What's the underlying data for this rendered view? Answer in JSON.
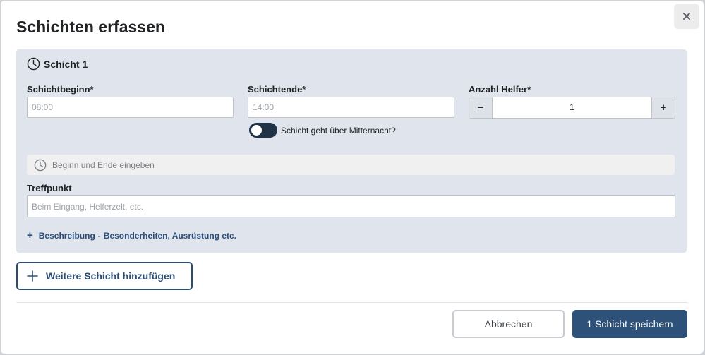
{
  "dialog": {
    "title": "Schichten erfassen",
    "close_icon": "close-icon"
  },
  "shift": {
    "title": "Schicht 1",
    "start": {
      "label": "Schichtbeginn*",
      "placeholder": "08:00",
      "value": ""
    },
    "end": {
      "label": "Schichtende*",
      "placeholder": "14:00",
      "value": ""
    },
    "helpers": {
      "label": "Anzahl Helfer*",
      "value": "1",
      "minus": "−",
      "plus": "+"
    },
    "overnight": {
      "label": "Schicht geht über Mitternacht?",
      "enabled": false
    },
    "hint": "Beginn und Ende eingeben",
    "meeting_point": {
      "label": "Treffpunkt",
      "placeholder": "Beim Eingang, Helferzelt, etc.",
      "value": ""
    },
    "description_link": {
      "plus": "+",
      "label": "Beschreibung",
      "dash": "-",
      "hint": "Besonderheiten, Ausrüstung etc."
    }
  },
  "add_shift": {
    "label": "Weitere Schicht hinzufügen"
  },
  "footer": {
    "cancel_label": "Abbrechen",
    "save_label": "1 Schicht speichern"
  },
  "colors": {
    "primary": "#2d5179",
    "card_background": "#dfe4ed",
    "toggle": "#1f3246"
  }
}
